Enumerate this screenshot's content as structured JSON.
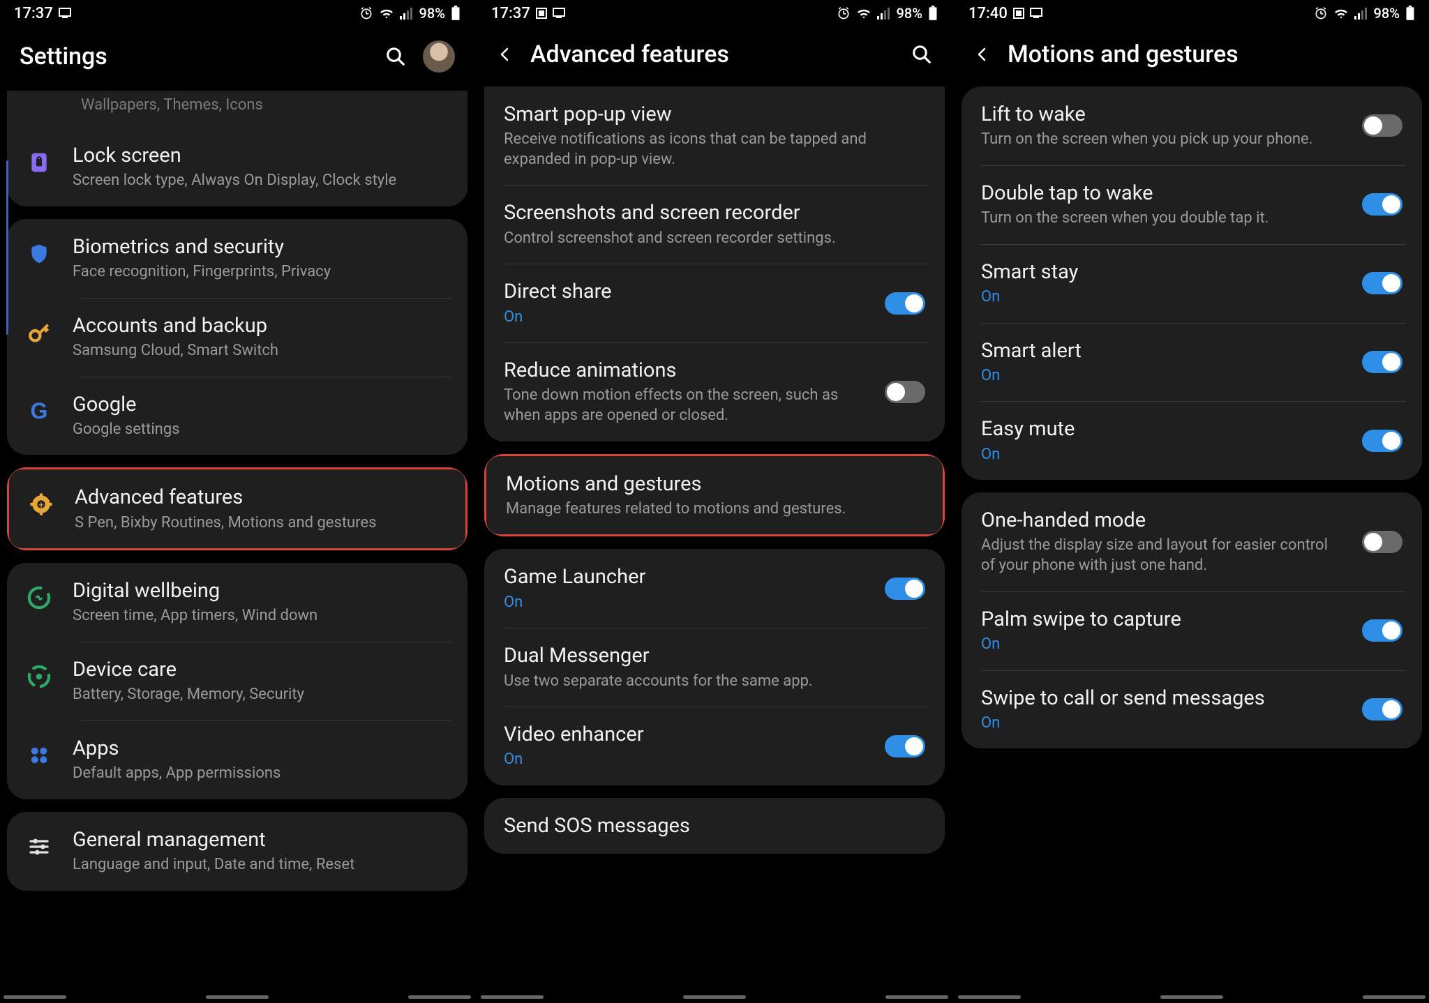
{
  "screens": [
    {
      "status": {
        "time": "17:37",
        "battery": "98%"
      },
      "header": {
        "title": "Settings",
        "has_back": false,
        "has_search": true,
        "has_avatar": true
      },
      "faded_row": "Wallpapers, Themes, Icons",
      "groups": [
        {
          "rows": [
            {
              "icon": "lock-icon",
              "color": "#8a6cf0",
              "label": "Lock screen",
              "sub": "Screen lock type, Always On Display, Clock style"
            }
          ],
          "truncated_top": true
        },
        {
          "rows": [
            {
              "icon": "shield-icon",
              "color": "#3a79e0",
              "label": "Biometrics and security",
              "sub": "Face recognition, Fingerprints, Privacy"
            },
            {
              "icon": "key-icon",
              "color": "#e8a63a",
              "label": "Accounts and backup",
              "sub": "Samsung Cloud, Smart Switch"
            },
            {
              "icon": "google-icon",
              "color": "#3a79e0",
              "label": "Google",
              "sub": "Google settings"
            }
          ]
        },
        {
          "rows": [
            {
              "icon": "gear-plus-icon",
              "color": "#e8a63a",
              "label": "Advanced features",
              "sub": "S Pen, Bixby Routines, Motions and gestures",
              "highlight": true
            }
          ]
        },
        {
          "rows": [
            {
              "icon": "wellbeing-icon",
              "color": "#2ea866",
              "label": "Digital wellbeing",
              "sub": "Screen time, App timers, Wind down"
            },
            {
              "icon": "device-care-icon",
              "color": "#2ea866",
              "label": "Device care",
              "sub": "Battery, Storage, Memory, Security"
            },
            {
              "icon": "apps-icon",
              "color": "#3a79e0",
              "label": "Apps",
              "sub": "Default apps, App permissions"
            }
          ]
        },
        {
          "rows": [
            {
              "icon": "sliders-icon",
              "color": "#e0e0e0",
              "label": "General management",
              "sub": "Language and input, Date and time, Reset"
            }
          ]
        }
      ]
    },
    {
      "status": {
        "time": "17:37",
        "battery": "98%"
      },
      "header": {
        "title": "Advanced features",
        "has_back": true,
        "has_search": true,
        "has_avatar": false
      },
      "groups": [
        {
          "truncated_top": true,
          "rows": [
            {
              "label": "Smart pop-up view",
              "sub": "Receive notifications as icons that can be tapped and expanded in pop-up view."
            },
            {
              "label": "Screenshots and screen recorder",
              "sub": "Control screenshot and screen recorder settings."
            },
            {
              "label": "Direct share",
              "sub": "On",
              "sub_on": true,
              "toggle": "on"
            },
            {
              "label": "Reduce animations",
              "sub": "Tone down motion effects on the screen, such as when apps are opened or closed.",
              "toggle": "off"
            }
          ]
        },
        {
          "rows": [
            {
              "label": "Motions and gestures",
              "sub": "Manage features related to motions and gestures.",
              "highlight": true
            }
          ]
        },
        {
          "rows": [
            {
              "label": "Game Launcher",
              "sub": "On",
              "sub_on": true,
              "toggle": "on"
            },
            {
              "label": "Dual Messenger",
              "sub": "Use two separate accounts for the same app."
            },
            {
              "label": "Video enhancer",
              "sub": "On",
              "sub_on": true,
              "toggle": "on"
            }
          ]
        },
        {
          "rows": [
            {
              "label": "Send SOS messages"
            }
          ]
        }
      ]
    },
    {
      "status": {
        "time": "17:40",
        "battery": "98%"
      },
      "header": {
        "title": "Motions and gestures",
        "has_back": true,
        "has_search": false,
        "has_avatar": false
      },
      "groups": [
        {
          "rows": [
            {
              "label": "Lift to wake",
              "sub": "Turn on the screen when you pick up your phone.",
              "toggle": "off"
            },
            {
              "label": "Double tap to wake",
              "sub": "Turn on the screen when you double tap it.",
              "toggle": "on"
            },
            {
              "label": "Smart stay",
              "sub": "On",
              "sub_on": true,
              "toggle": "on"
            },
            {
              "label": "Smart alert",
              "sub": "On",
              "sub_on": true,
              "toggle": "on"
            },
            {
              "label": "Easy mute",
              "sub": "On",
              "sub_on": true,
              "toggle": "on"
            }
          ]
        },
        {
          "rows": [
            {
              "label": "One-handed mode",
              "sub": "Adjust the display size and layout for easier control of your phone with just one hand.",
              "toggle": "off"
            },
            {
              "label": "Palm swipe to capture",
              "sub": "On",
              "sub_on": true,
              "toggle": "on"
            },
            {
              "label": "Swipe to call or send messages",
              "sub": "On",
              "sub_on": true,
              "toggle": "on"
            }
          ]
        }
      ]
    }
  ],
  "icons_status": {
    "alarm": "⏰",
    "wifi": "📶",
    "signal": "▮",
    "battery": "▮"
  }
}
